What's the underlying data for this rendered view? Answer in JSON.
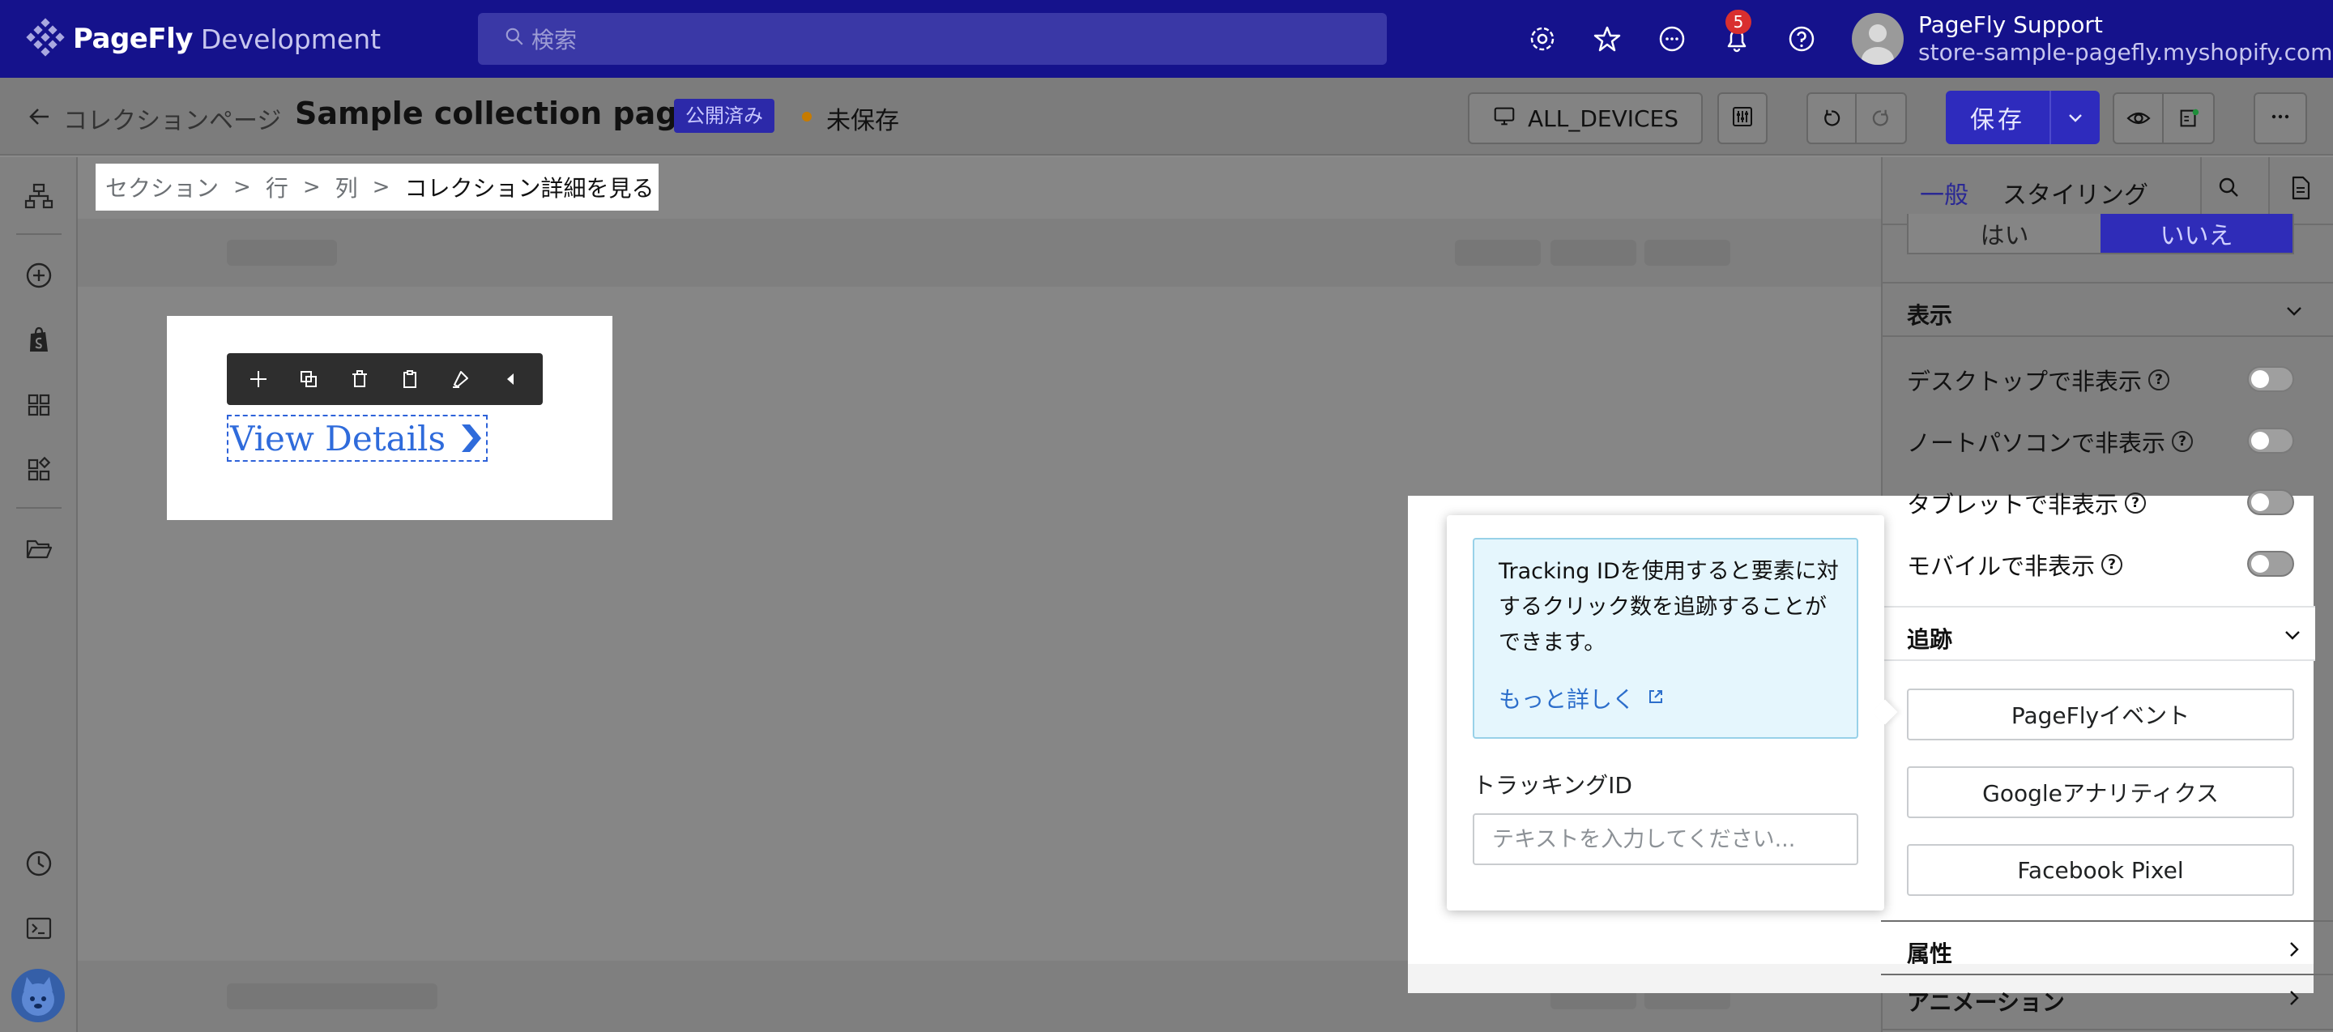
{
  "topbar": {
    "logo_text": "PageFly",
    "logo_sub": "Development",
    "search_placeholder": "検索",
    "notification_count": "5",
    "user_name": "PageFly Support",
    "user_store": "store-sample-pagefly.myshopify.com"
  },
  "header": {
    "back_label": "コレクションページ",
    "title": "Sample collection page",
    "status_published": "公開済み",
    "status_unsaved": "未保存",
    "device_label": "ALL_DEVICES",
    "save_label": "保存"
  },
  "breadcrumb": {
    "items": [
      "セクション",
      "行",
      "列",
      "コレクション詳細を見る"
    ],
    "separator": ">"
  },
  "canvas": {
    "element_text": "View Details"
  },
  "panel": {
    "tabs": [
      "一般",
      "スタイリング"
    ],
    "segment": {
      "yes": "はい",
      "no": "いいえ"
    },
    "display_section": "表示",
    "visibility": [
      {
        "label": "デスクトップで非表示",
        "on": false
      },
      {
        "label": "ノートパソコンで非表示",
        "on": false
      },
      {
        "label": "タブレットで非表示",
        "on": false
      },
      {
        "label": "モバイルで非表示",
        "on": false
      }
    ],
    "tracking_section": "追跡",
    "tracking_buttons": [
      "PageFlyイベント",
      "Googleアナリティクス",
      "Facebook Pixel"
    ],
    "attributes_section": "属性",
    "animation_section": "アニメーション"
  },
  "popover": {
    "info_text": "Tracking IDを使用すると要素に対するクリック数を追跡することができます。",
    "learn_more": "もっと詳しく",
    "tracking_id_label": "トラッキングID",
    "tracking_id_placeholder": "テキストを入力してください...",
    "tracking_id_value": ""
  },
  "colors": {
    "topbar": "#15128c",
    "primary": "#2e2bbd",
    "info_bg": "#e5f6fd",
    "link": "#2c6ecb"
  }
}
